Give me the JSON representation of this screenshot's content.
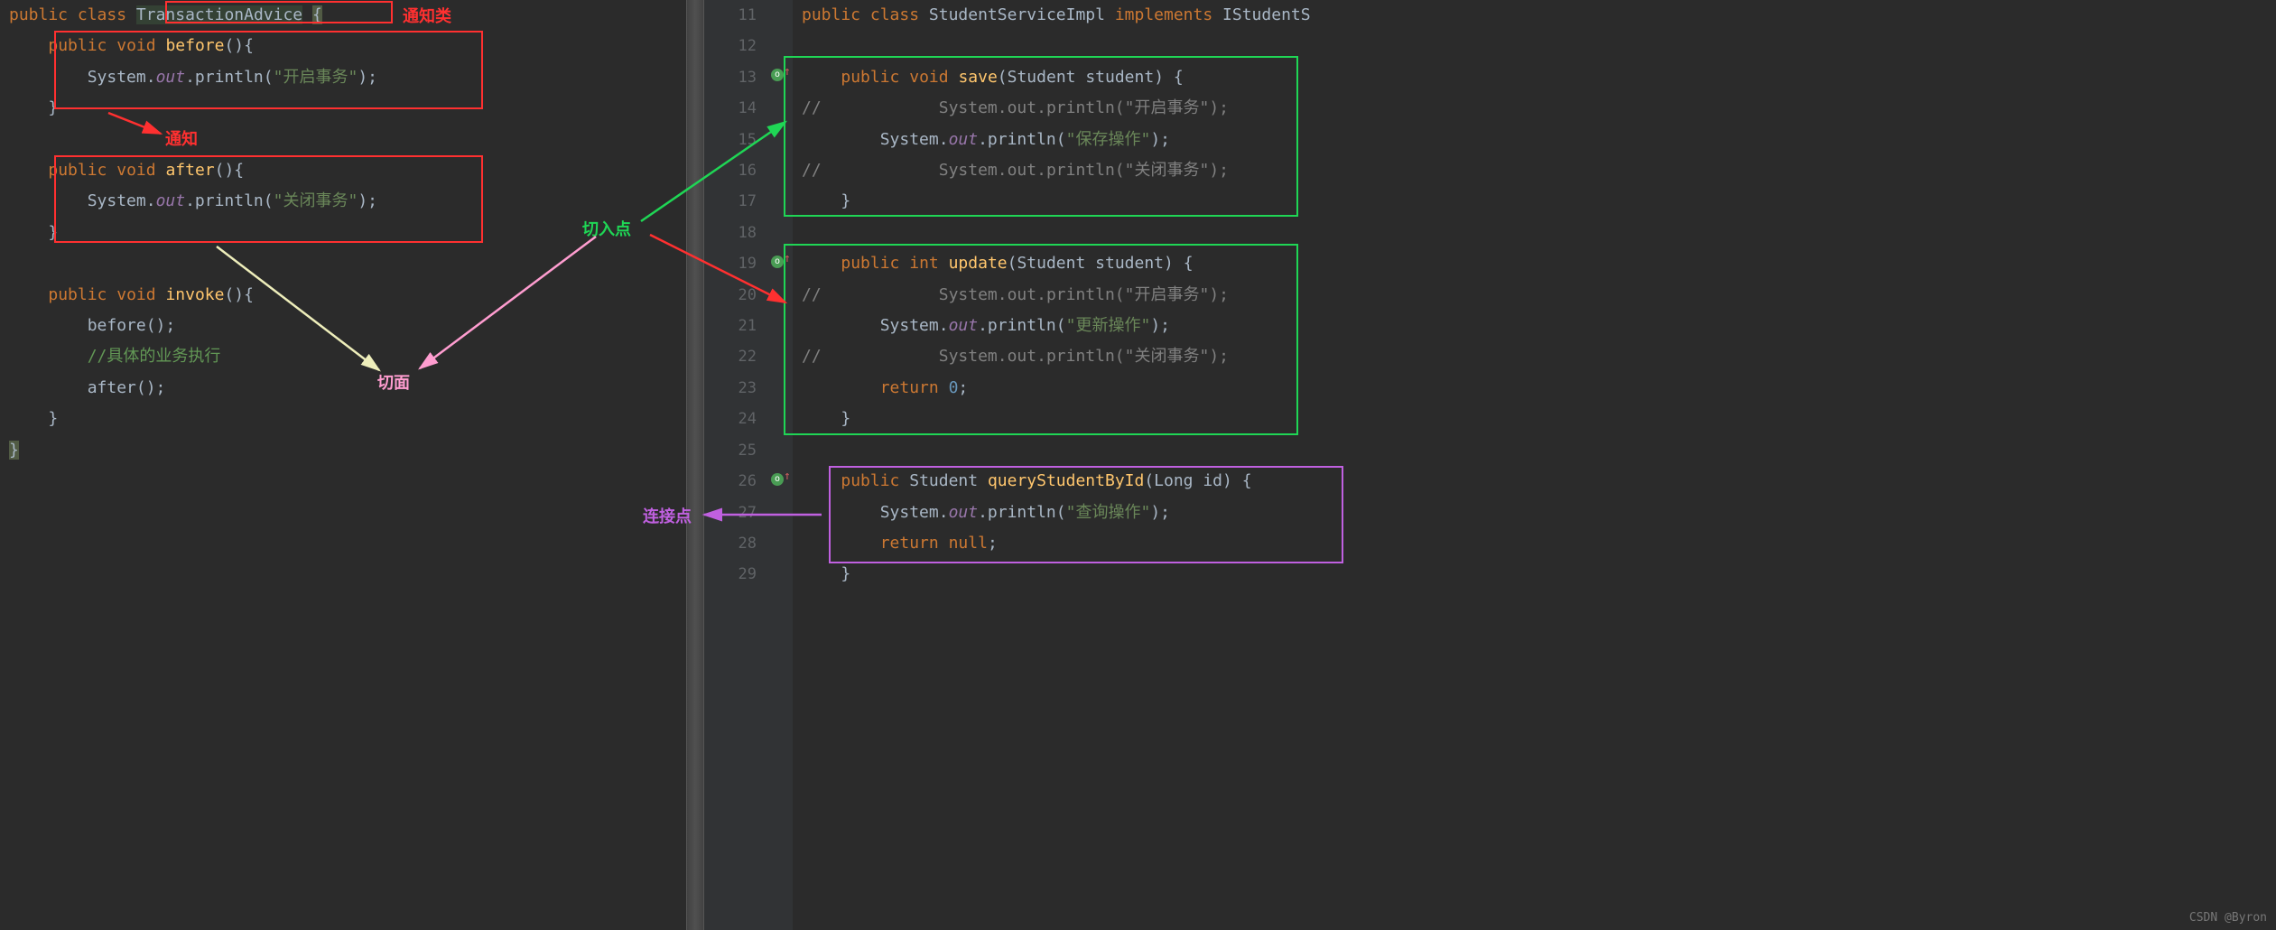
{
  "left": {
    "class_decl": {
      "kw1": "public",
      "kw2": "class",
      "name": "TransactionAdvice",
      "brace": "{"
    },
    "before": {
      "sig": {
        "kw1": "public",
        "kw2": "void",
        "name": "before",
        "suffix": "(){"
      },
      "body": {
        "prefix": "System.",
        "field": "out",
        "mid": ".println(",
        "str": "\"开启事务\"",
        "end": ");"
      },
      "close": "}"
    },
    "after": {
      "sig": {
        "kw1": "public",
        "kw2": "void",
        "name": "after",
        "suffix": "(){"
      },
      "body": {
        "prefix": "System.",
        "field": "out",
        "mid": ".println(",
        "str": "\"关闭事务\"",
        "end": ");"
      },
      "close": "}"
    },
    "invoke": {
      "sig": {
        "kw1": "public",
        "kw2": "void",
        "name": "invoke",
        "suffix": "(){"
      },
      "l1": "before();",
      "comment": "//具体的业务执行",
      "l3": "after();",
      "close": "}"
    },
    "class_close": "}"
  },
  "right": {
    "line_numbers": [
      "11",
      "12",
      "13",
      "14",
      "15",
      "16",
      "17",
      "18",
      "19",
      "20",
      "21",
      "22",
      "23",
      "24",
      "25",
      "26",
      "27",
      "28",
      "29"
    ],
    "class_decl": {
      "kw1": "public",
      "kw2": "class",
      "name": "StudentServiceImpl",
      "kw3": "implements",
      "iface": "IStudentS"
    },
    "save": {
      "sig": {
        "kw1": "public",
        "kw2": "void",
        "name": "save",
        "params": "(Student student) {"
      },
      "l1": {
        "c": "//",
        "pre": "System.out.println(",
        "str": "\"开启事务\"",
        "end": ");"
      },
      "l2": {
        "pre": "System.",
        "field": "out",
        "mid": ".println(",
        "str": "\"保存操作\"",
        "end": ");"
      },
      "l3": {
        "c": "//",
        "pre": "System.out.println(",
        "str": "\"关闭事务\"",
        "end": ");"
      },
      "close": "}"
    },
    "update": {
      "sig": {
        "kw1": "public",
        "kw2": "int",
        "name": "update",
        "params": "(Student student) {"
      },
      "l1": {
        "c": "//",
        "pre": "System.out.println(",
        "str": "\"开启事务\"",
        "end": ");"
      },
      "l2": {
        "pre": "System.",
        "field": "out",
        "mid": ".println(",
        "str": "\"更新操作\"",
        "end": ");"
      },
      "l3": {
        "c": "//",
        "pre": "System.out.println(",
        "str": "\"关闭事务\"",
        "end": ");"
      },
      "ret": {
        "kw": "return",
        "val": "0",
        "semi": ";"
      },
      "close": "}"
    },
    "query": {
      "sig": {
        "kw1": "public",
        "ret": "Student",
        "name": "queryStudentById",
        "params": "(Long id) {"
      },
      "l1": {
        "pre": "System.",
        "field": "out",
        "mid": ".println(",
        "str": "\"查询操作\"",
        "end": ");"
      },
      "ret": {
        "kw": "return",
        "val": "null",
        "semi": ";"
      },
      "close": "}"
    }
  },
  "labels": {
    "advice_class": "通知类",
    "advice": "通知",
    "aspect": "切面",
    "pointcut": "切入点",
    "joinpoint": "连接点"
  },
  "watermark": "CSDN @Byron"
}
